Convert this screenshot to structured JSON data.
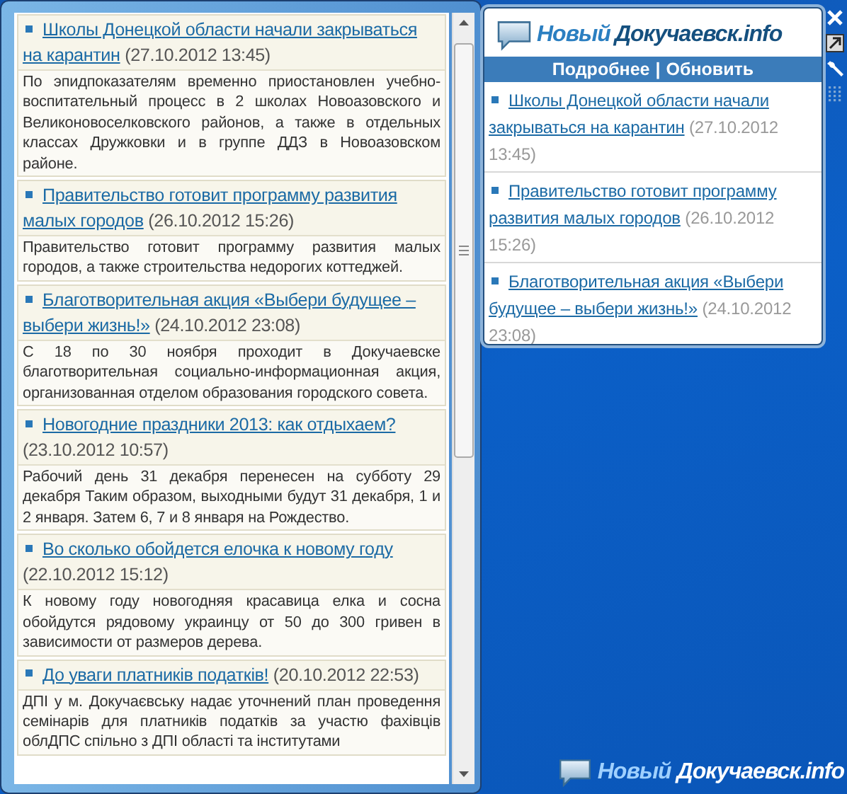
{
  "flyout": {
    "items": [
      {
        "title": "Школы Донецкой области начали закрываться на карантин",
        "date": "(27.10.2012 13:45)",
        "summary": "По эпидпоказателям временно приостановлен учебно-воспитательный процесс в 2 школах Новоазовского и Великоновоселковского районов, а также в отдельных классах Дружковки и в группе ДДЗ в Новоазовском районе."
      },
      {
        "title": "Правительство готовит программу развития малых городов",
        "date": "(26.10.2012 15:26)",
        "summary": "Правительство готовит программу развития малых городов, а также строительства недорогих коттеджей."
      },
      {
        "title": "Благотворительная акция «Выбери будущее – выбери жизнь!»",
        "date": "(24.10.2012 23:08)",
        "summary": "С 18 по 30 ноября проходит в Докучаевске благотворительная социально-информационная акция, организованная отделом образования городского совета."
      },
      {
        "title": "Новогодние праздники 2013: как отдыхаем?",
        "date": "(23.10.2012 10:57)",
        "summary": "Рабочий день 31 декабря перенесен на субботу 29 декабря Таким образом, выходными будут 31 декабря, 1 и 2 января. Затем 6, 7 и 8 января на Рождество."
      },
      {
        "title": "Во сколько обойдется елочка к новому году",
        "date": "(22.10.2012 15:12)",
        "summary": "К новому году новогодняя красавица елка и сосна обойдутся рядовому украинцу от 50 до 300 гривен в зависимости от размеров дерева."
      },
      {
        "title": "До уваги платників податків!",
        "date": "(20.10.2012 22:53)",
        "summary": "ДПІ у м. Докучаєвську надає уточнений план проведення семінарів для платників податків за участю фахівців облДПС спільно з ДПІ області та інститутами"
      }
    ]
  },
  "gadget": {
    "logo_prefix": "Новый",
    "logo_name": "Докучаевск.info",
    "links": [
      "Подробнее",
      "Обновить"
    ],
    "separator": "|",
    "items": [
      {
        "title": "Школы Донецкой области начали закрываться на карантин",
        "date": "(27.10.2012 13:45)"
      },
      {
        "title": "Правительство готовит программу развития малых городов",
        "date": "(26.10.2012 15:26)"
      },
      {
        "title": "Благотворительная акция «Выбери будущее – выбери жизнь!»",
        "date": "(24.10.2012 23:08)"
      }
    ]
  },
  "desktop_logo": {
    "logo_prefix": "Новый",
    "logo_name": "Докучаевск.info"
  }
}
